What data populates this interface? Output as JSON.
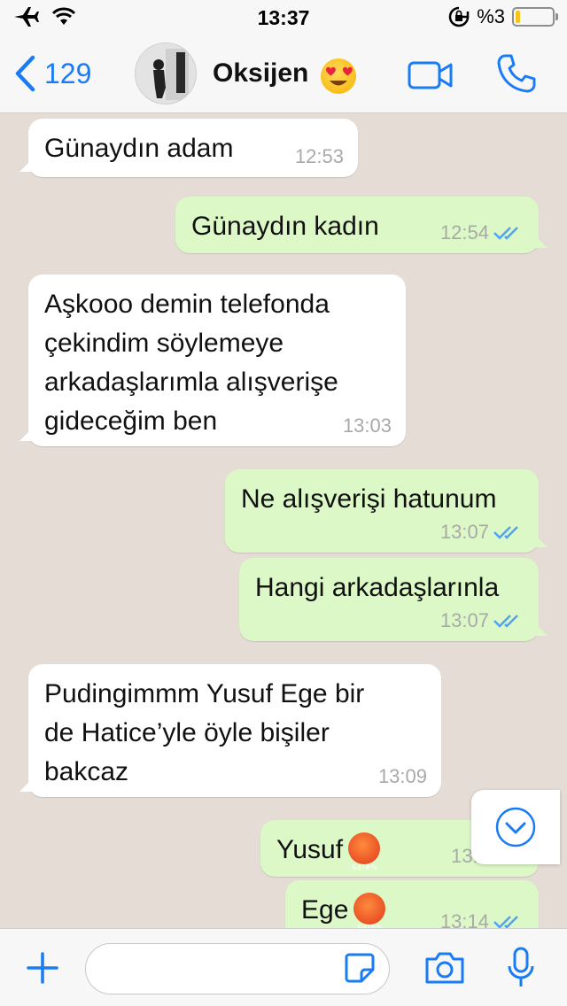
{
  "status_bar": {
    "time": "13:37",
    "battery_text": "%3",
    "battery_level": 0.03
  },
  "header": {
    "back_count": "129",
    "contact_name": "Oksijen",
    "contact_emoji": "heart-eyes-emoji"
  },
  "messages": [
    {
      "direction": "in",
      "text": "Günaydın adam",
      "time": "12:53"
    },
    {
      "direction": "out",
      "text": "Günaydın kadın",
      "time": "12:54",
      "read": true
    },
    {
      "direction": "in",
      "text": "Aşkooo demin telefonda\nçekindim söylemeye\narkadaşlarımla alışverişe\ngideceğim  ben",
      "time": "13:03"
    },
    {
      "direction": "out",
      "text": "Ne alışverişi hatunum",
      "time": "13:07",
      "read": true
    },
    {
      "direction": "out",
      "text": "Hangi arkadaşlarınla",
      "time": "13:07",
      "read": true
    },
    {
      "direction": "in",
      "text": "Pudingimmm Yusuf Ege bir\nde Hatice’yle öyle bişiler\nbakcaz",
      "time": "13:09"
    },
    {
      "direction": "out",
      "text": "Yusuf",
      "emoji": "cursing-face-emoji",
      "time": "13:1",
      "read": true
    },
    {
      "direction": "out",
      "text": "Ege",
      "emoji": "cursing-face-emoji",
      "time": "13:14",
      "read": true
    }
  ],
  "colors": {
    "accent": "#1a7cf5",
    "read_ticks": "#4fa3f7",
    "incoming": "#ffffff",
    "outgoing": "#dcf8c6",
    "chat_bg": "#e5ddd5"
  },
  "icons": [
    "airplane-icon",
    "wifi-icon",
    "rotation-lock-icon",
    "video-call-icon",
    "phone-icon",
    "plus-icon",
    "sticker-icon",
    "camera-icon",
    "microphone-icon",
    "scroll-down-icon"
  ]
}
